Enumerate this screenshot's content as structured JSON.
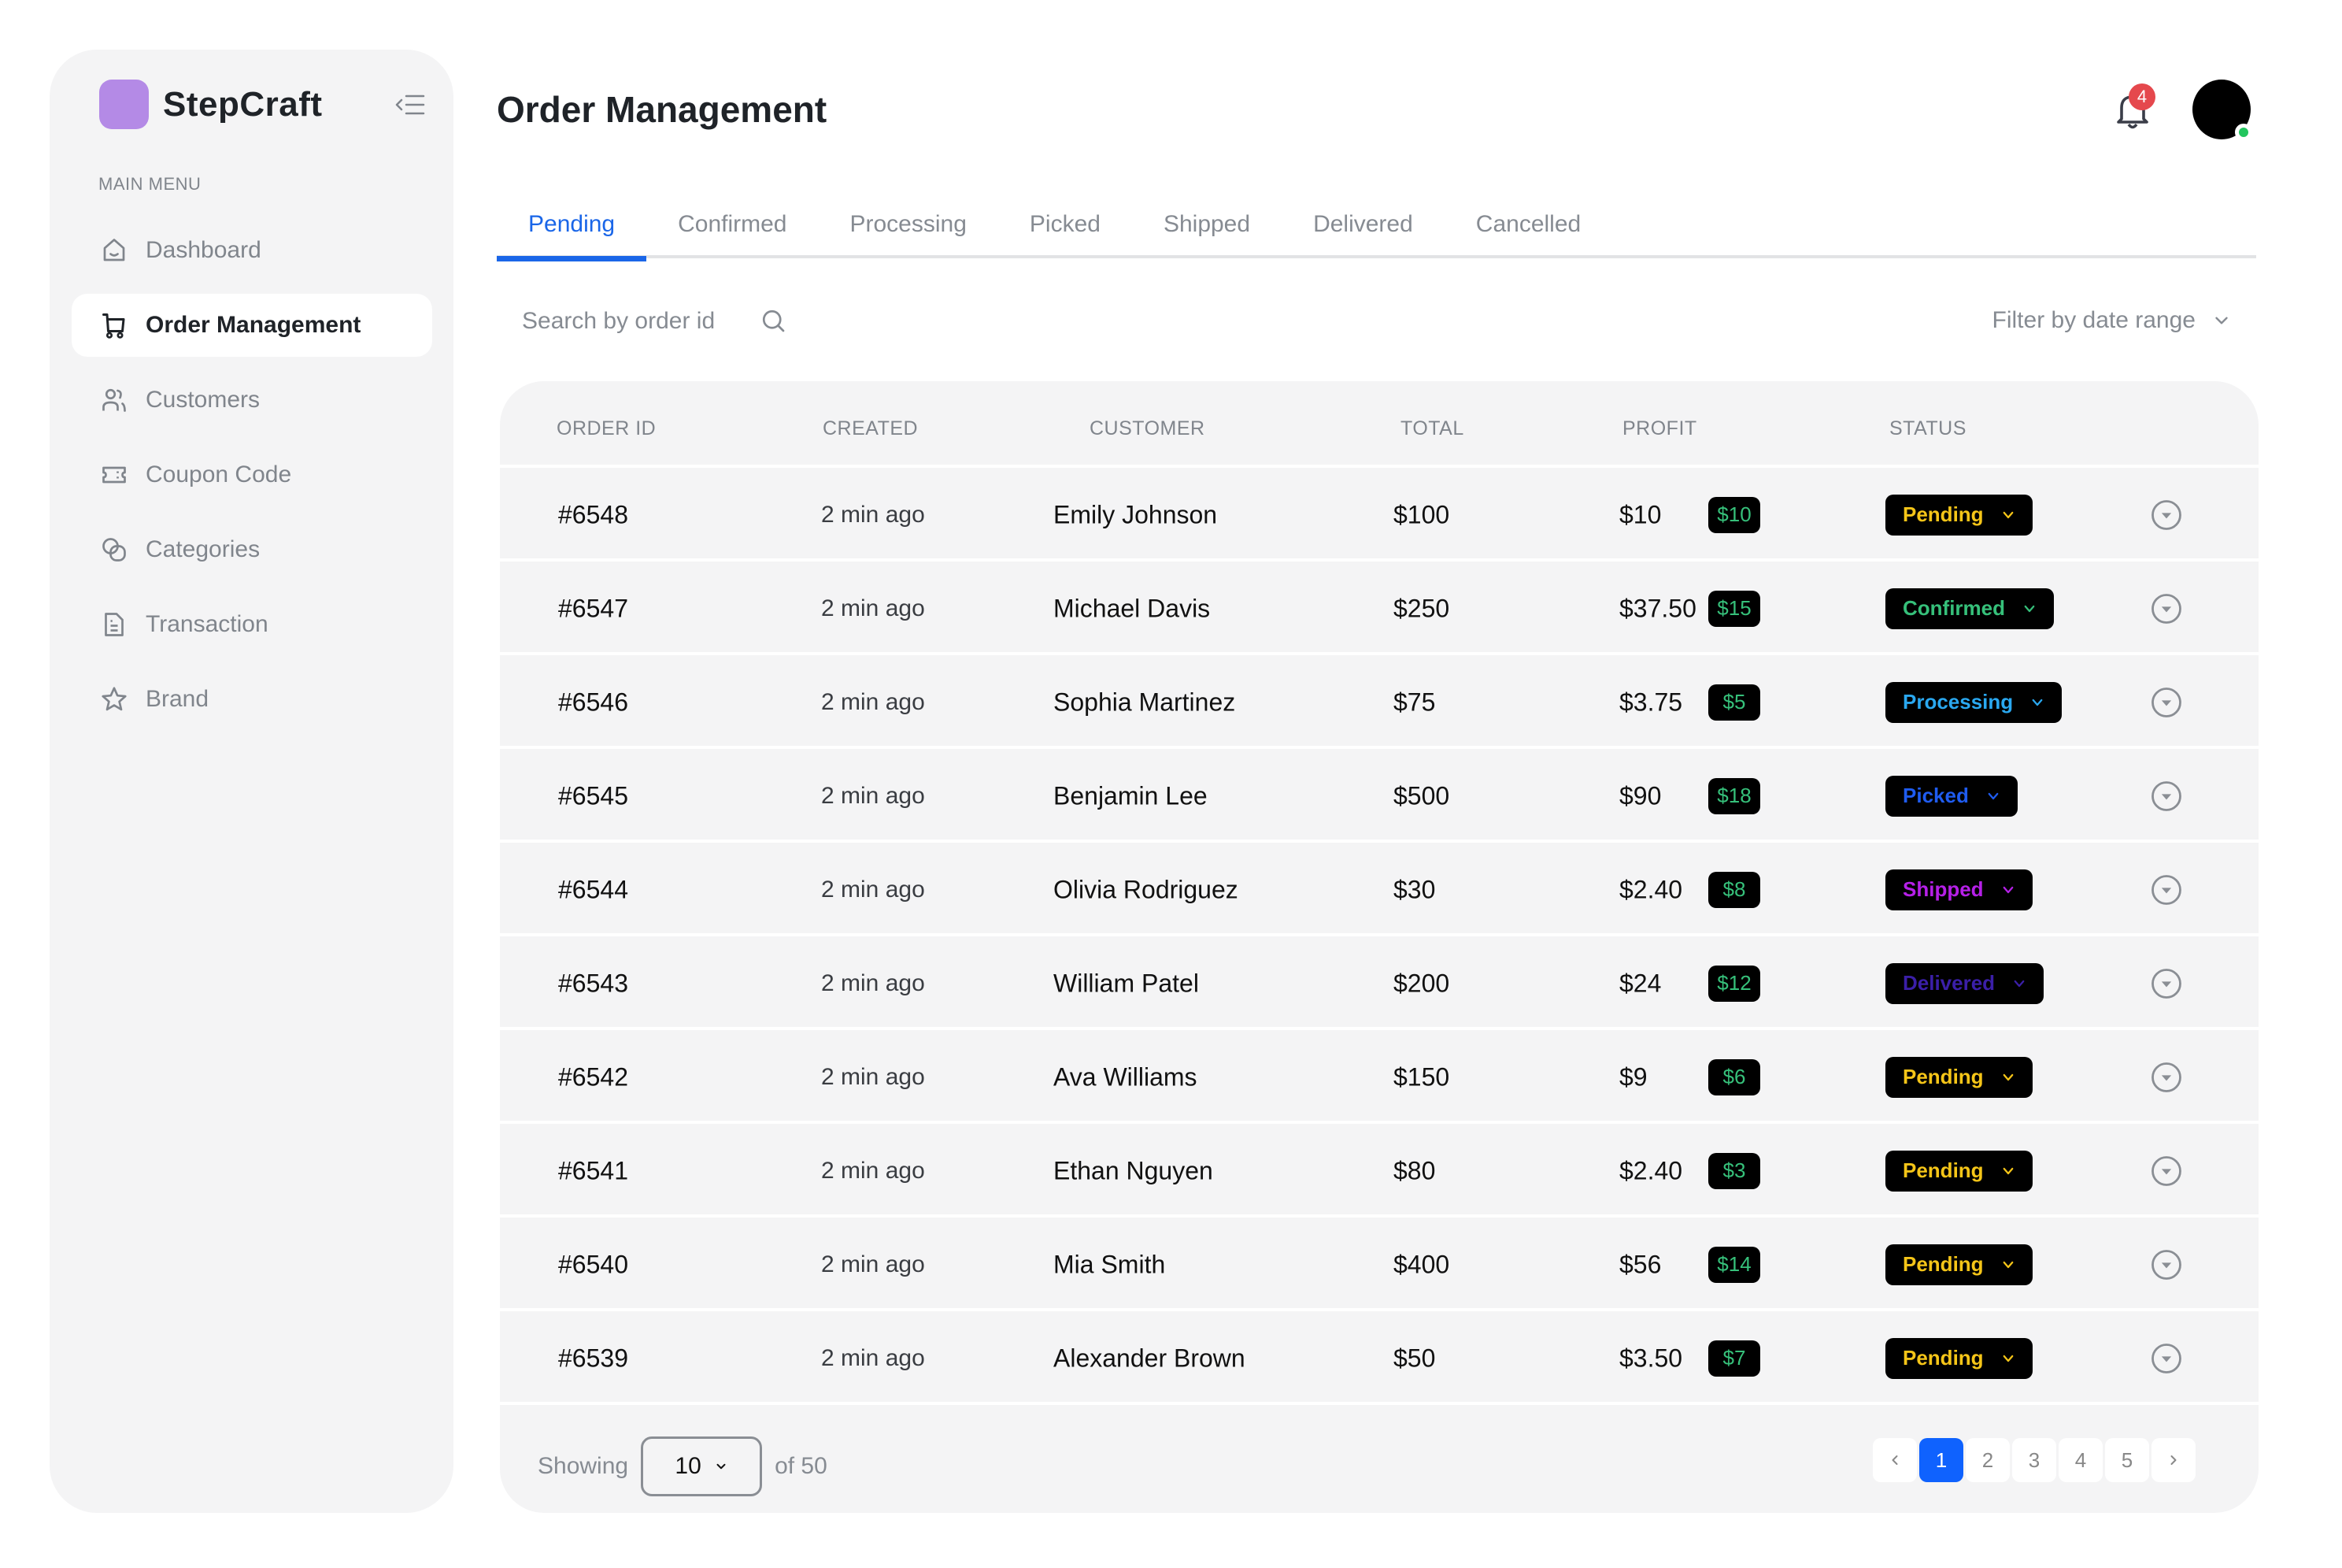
{
  "app": {
    "name": "StepCraft",
    "brand_color": "#b48ae6",
    "accent_color": "#1a66e8"
  },
  "sidebar": {
    "section_label": "MAIN MENU",
    "items": [
      {
        "label": "Dashboard",
        "icon": "home-icon",
        "active": false
      },
      {
        "label": "Order Management",
        "icon": "cart-icon",
        "active": true
      },
      {
        "label": "Customers",
        "icon": "users-icon",
        "active": false
      },
      {
        "label": "Coupon Code",
        "icon": "ticket-icon",
        "active": false
      },
      {
        "label": "Categories",
        "icon": "categories-icon",
        "active": false
      },
      {
        "label": "Transaction",
        "icon": "document-icon",
        "active": false
      },
      {
        "label": "Brand",
        "icon": "star-icon",
        "active": false
      }
    ]
  },
  "header": {
    "title": "Order Management",
    "notifications_count": "4"
  },
  "tabs": [
    {
      "label": "Pending",
      "active": true
    },
    {
      "label": "Confirmed",
      "active": false
    },
    {
      "label": "Processing",
      "active": false
    },
    {
      "label": "Picked",
      "active": false
    },
    {
      "label": "Shipped",
      "active": false
    },
    {
      "label": "Delivered",
      "active": false
    },
    {
      "label": "Cancelled",
      "active": false
    }
  ],
  "search": {
    "placeholder": "Search by order id",
    "value": ""
  },
  "filter": {
    "label": "Filter by date range"
  },
  "table": {
    "columns": [
      "ORDER ID",
      "CREATED",
      "CUSTOMER",
      "TOTAL",
      "PROFIT",
      "STATUS"
    ],
    "rows": [
      {
        "order_id": "#6548",
        "created": "2 min ago",
        "customer": "Emily Johnson",
        "total": "$100",
        "profit": "$10",
        "profit_badge": "$10",
        "status": "Pending"
      },
      {
        "order_id": "#6547",
        "created": "2 min ago",
        "customer": "Michael Davis",
        "total": "$250",
        "profit": "$37.50",
        "profit_badge": "$15",
        "status": "Confirmed"
      },
      {
        "order_id": "#6546",
        "created": "2 min ago",
        "customer": "Sophia Martinez",
        "total": "$75",
        "profit": "$3.75",
        "profit_badge": "$5",
        "status": "Processing"
      },
      {
        "order_id": "#6545",
        "created": "2 min ago",
        "customer": "Benjamin Lee",
        "total": "$500",
        "profit": "$90",
        "profit_badge": "$18",
        "status": "Picked"
      },
      {
        "order_id": "#6544",
        "created": "2 min ago",
        "customer": "Olivia Rodriguez",
        "total": "$30",
        "profit": "$2.40",
        "profit_badge": "$8",
        "status": "Shipped"
      },
      {
        "order_id": "#6543",
        "created": "2 min ago",
        "customer": "William Patel",
        "total": "$200",
        "profit": "$24",
        "profit_badge": "$12",
        "status": "Delivered"
      },
      {
        "order_id": "#6542",
        "created": "2 min ago",
        "customer": "Ava Williams",
        "total": "$150",
        "profit": "$9",
        "profit_badge": "$6",
        "status": "Pending"
      },
      {
        "order_id": "#6541",
        "created": "2 min ago",
        "customer": "Ethan Nguyen",
        "total": "$80",
        "profit": "$2.40",
        "profit_badge": "$3",
        "status": "Pending"
      },
      {
        "order_id": "#6540",
        "created": "2 min ago",
        "customer": "Mia Smith",
        "total": "$400",
        "profit": "$56",
        "profit_badge": "$14",
        "status": "Pending"
      },
      {
        "order_id": "#6539",
        "created": "2 min ago",
        "customer": "Alexander Brown",
        "total": "$50",
        "profit": "$3.50",
        "profit_badge": "$7",
        "status": "Pending"
      }
    ],
    "status_colors": {
      "Pending": "#f5c518",
      "Confirmed": "#36c07a",
      "Processing": "#2aa8f0",
      "Picked": "#1f5cf0",
      "Shipped": "#b620e8",
      "Delivered": "#3b1fa8"
    },
    "profit_badge_color": "#36c07a"
  },
  "footer": {
    "showing_label": "Showing",
    "page_size": "10",
    "of_label": "of 50",
    "pages": [
      "1",
      "2",
      "3",
      "4",
      "5"
    ],
    "current_page": "1"
  }
}
